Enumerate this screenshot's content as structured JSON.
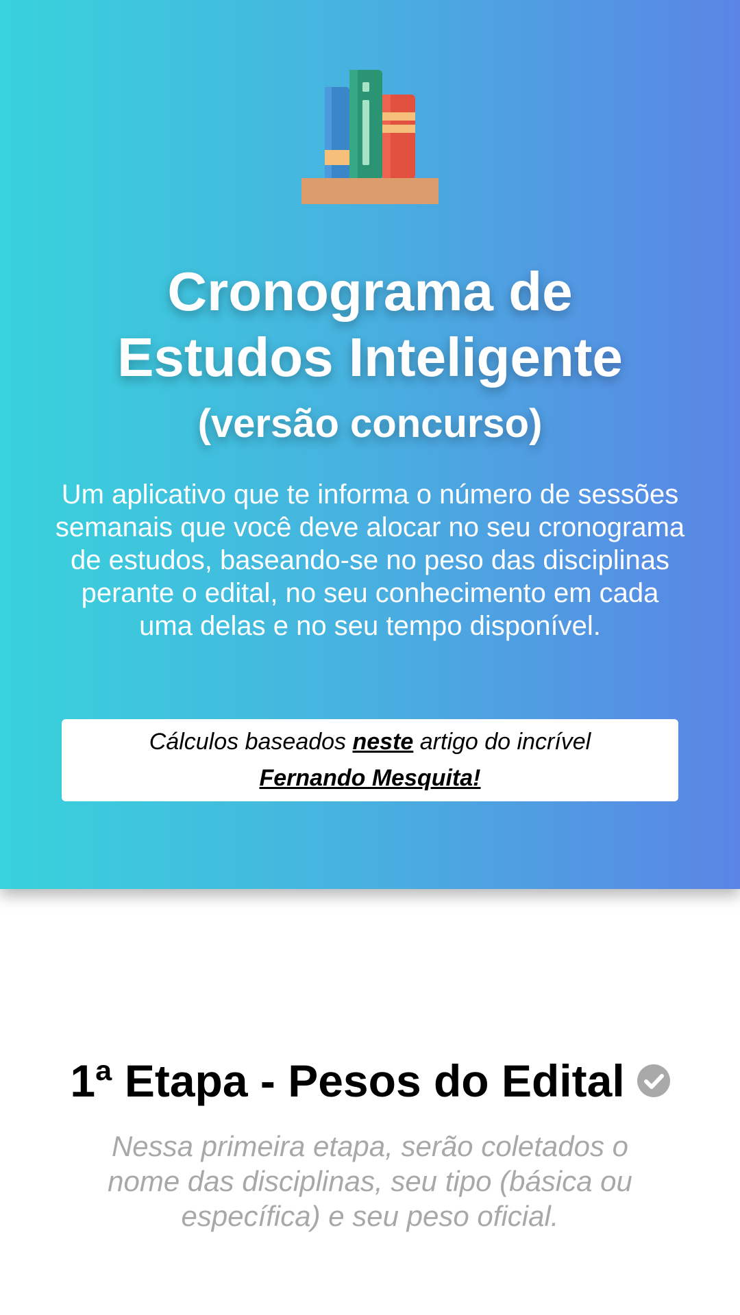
{
  "header": {
    "logo_icon": "books-on-shelf-icon",
    "title_line1": "Cronograma de",
    "title_line2": "Estudos Inteligente",
    "subtitle": "(versão concurso)",
    "description": "Um aplicativo que te informa o número de sessões semanais que você deve alocar no seu cronograma de estudos, baseando-se no peso das disciplinas perante o edital, no seu conhecimento em cada uma delas e no seu tempo disponível.",
    "credits": {
      "prefix": "Cálculos baseados ",
      "article_link": "neste",
      "middle": " artigo do incrível",
      "author_link": "Fernando Mesquita!"
    },
    "gradient": [
      "#38d2dc",
      "#5a85e5"
    ]
  },
  "step1": {
    "title": "1ª Etapa - Pesos do Edital",
    "status_icon": "check-circle-icon",
    "description": "Nessa primeira etapa, serão coletados o nome das disciplinas, seu tipo (básica ou específica) e seu peso oficial."
  }
}
